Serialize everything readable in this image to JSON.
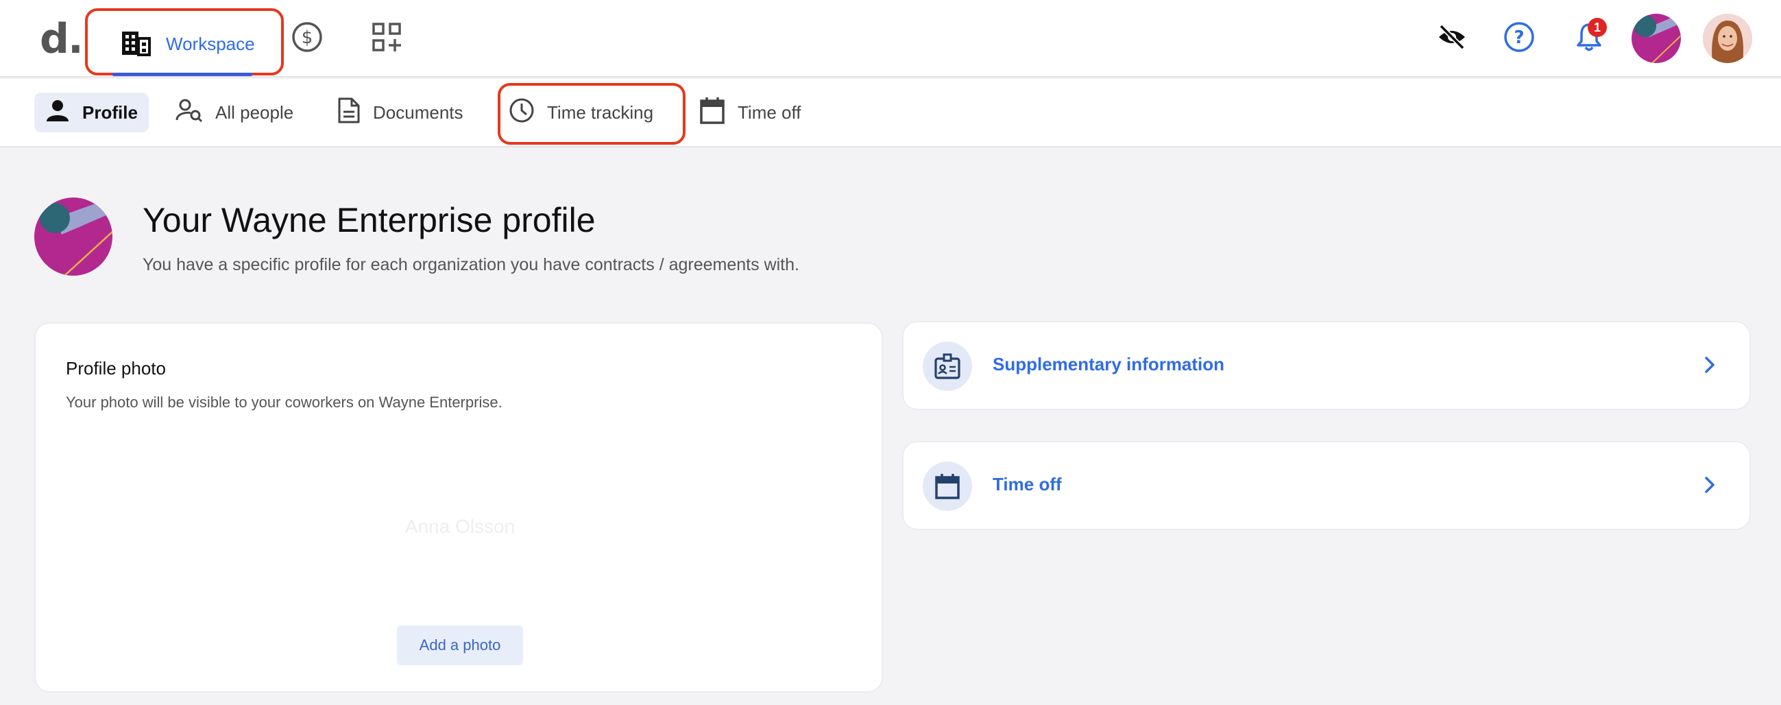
{
  "topnav": {
    "logo": "d.",
    "workspace_label": "Workspace",
    "notification_count": "1"
  },
  "subnav": {
    "tabs": [
      {
        "label": "Profile"
      },
      {
        "label": "All people"
      },
      {
        "label": "Documents"
      },
      {
        "label": "Time tracking"
      },
      {
        "label": "Time off"
      }
    ]
  },
  "header": {
    "title": "Your Wayne Enterprise profile",
    "subtitle": "You have a specific profile for each organization you have contracts / agreements with."
  },
  "photo_card": {
    "title": "Profile photo",
    "description": "Your photo will be visible to your coworkers on Wayne Enterprise.",
    "placeholder_name": "Anna Olsson",
    "add_photo_label": "Add a photo"
  },
  "links": [
    {
      "label": "Supplementary information",
      "icon": "id-badge-icon"
    },
    {
      "label": "Time off",
      "icon": "calendar-icon"
    }
  ],
  "colors": {
    "accent": "#2f6ce5",
    "highlight": "#e4391e",
    "org_magenta": "#b3288e",
    "org_teal": "#2d6674"
  }
}
